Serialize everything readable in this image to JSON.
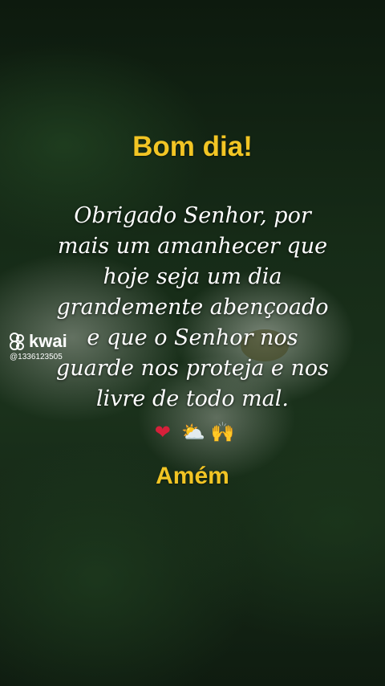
{
  "title": "Bom dia!",
  "message_lines": [
    "Obrigado Senhor, por",
    "mais um amanhecer que",
    "hoje seja um dia",
    "grandemente abençoado",
    "e que o Senhor nos",
    "guarde nos proteja e nos",
    "livre de todo mal."
  ],
  "emojis": {
    "heart": "❤",
    "sun_cloud": "⛅",
    "hands": "🙌"
  },
  "closing": "Amém",
  "watermark": {
    "brand": "kwai",
    "user": "@1336123505"
  },
  "colors": {
    "title": "#f2c524",
    "text": "#ffffff",
    "background": "#162b17"
  }
}
